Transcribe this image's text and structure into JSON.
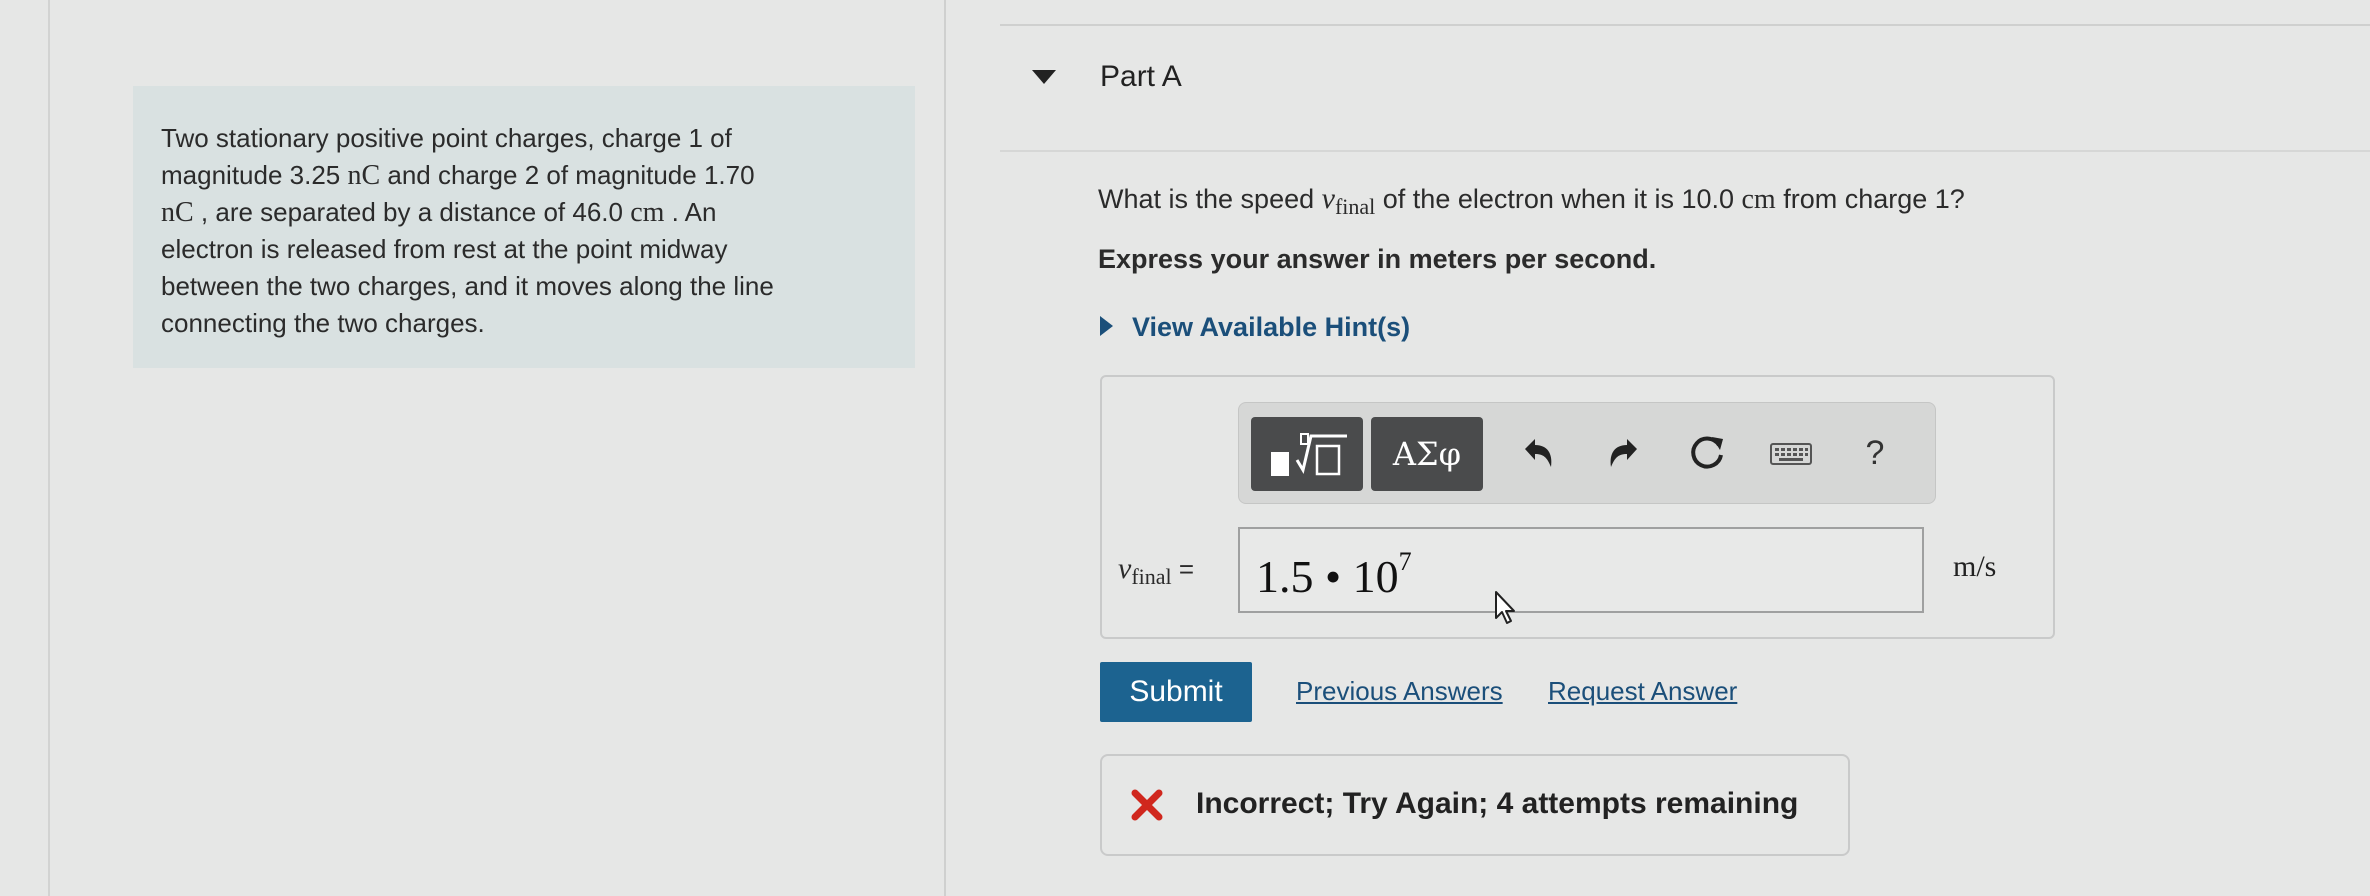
{
  "problem": {
    "line1": "Two stationary positive point charges, charge 1 of",
    "line2_pre": "magnitude 3.25 ",
    "line2_unit1": "nC",
    "line2_mid": " and charge 2 of magnitude 1.70",
    "line3_unit2": "nC",
    "line3_mid": " , are separated by a distance of 46.0 ",
    "line3_unit3": "cm",
    "line3_post": " . An",
    "line4": "electron is released from rest at the point midway",
    "line5": "between the two charges, and it moves along the line",
    "line6": "connecting the two charges."
  },
  "part": {
    "title": "Part A"
  },
  "question": {
    "pre": "What is the speed ",
    "var": "v",
    "sub": "final",
    "mid": " of the electron when it is 10.0 ",
    "unit": "cm",
    "post": " from charge 1?"
  },
  "instruction": "Express your answer in meters per second.",
  "hint_label": "View Available Hint(s)",
  "toolbar": {
    "greek_label": "ΑΣφ",
    "help_label": "?",
    "icons": [
      "templates-icon",
      "undo-icon",
      "redo-icon",
      "reset-icon",
      "keyboard-icon",
      "help-icon"
    ]
  },
  "answer": {
    "label_var": "v",
    "label_sub": "final",
    "label_eq": " =",
    "mantissa": "1.5 • 10",
    "exponent": "7",
    "unit": "m/s"
  },
  "actions": {
    "submit": "Submit",
    "previous_answers": "Previous Answers",
    "request_answer": "Request Answer"
  },
  "feedback": {
    "text": "Incorrect; Try Again; 4 attempts remaining",
    "icon_color": "#d0271d"
  },
  "colors": {
    "submit_bg": "#1c6390",
    "link": "#1b4f7a",
    "problem_bg": "#d9e1e1"
  }
}
